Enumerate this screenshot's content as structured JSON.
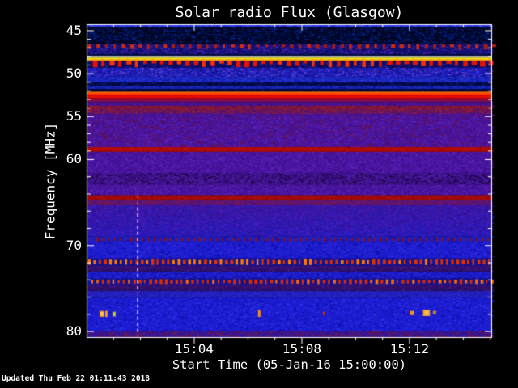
{
  "window": {
    "bg": "#000000",
    "fg": "#ffffff"
  },
  "chart_data": {
    "type": "heatmap",
    "title": "Solar radio Flux (Glasgow)",
    "xlabel": "Start Time (05-Jan-16 15:00:00)",
    "ylabel": "Frequency [MHz]",
    "updated": "Updated Thu Feb 22 01:11:43 2018",
    "x_axis": {
      "unit": "minutes after 15:00:00",
      "min_minutes": 0,
      "max_minutes": 15.07,
      "major_ticks": [
        {
          "minutes": 4,
          "label": "15:04"
        },
        {
          "minutes": 8,
          "label": "15:08"
        },
        {
          "minutes": 12,
          "label": "15:12"
        }
      ],
      "minor_tick_minutes": [
        1,
        2,
        3,
        5,
        6,
        7,
        9,
        10,
        11,
        13,
        14,
        15
      ]
    },
    "y_axis": {
      "unit": "MHz",
      "min_mhz": 44.25,
      "max_mhz": 80.65,
      "major_ticks": [
        {
          "mhz": 45,
          "label": "45"
        },
        {
          "mhz": 50,
          "label": "50"
        },
        {
          "mhz": 55,
          "label": "55"
        },
        {
          "mhz": 60,
          "label": "60"
        },
        {
          "mhz": 70,
          "label": "70"
        },
        {
          "mhz": 80,
          "label": "80"
        }
      ],
      "minor_tick_mhz": [
        46,
        47,
        48,
        49,
        51,
        52,
        53,
        54,
        56,
        57,
        58,
        59,
        62,
        64,
        66,
        68,
        72,
        74,
        76,
        78
      ]
    },
    "bands": [
      {
        "f0": 44.25,
        "f1": 44.55,
        "base": "#2733ee",
        "speckle": {
          "colors": [
            "#4d5cff",
            "#1a23c0"
          ],
          "d": 0.5
        }
      },
      {
        "f0": 44.55,
        "f1": 46.6,
        "base": "#000522",
        "speckle": {
          "colors": [
            "#001e7e",
            "#000f4a",
            "#062ba6",
            "#00081c"
          ],
          "d": 0.6
        }
      },
      {
        "f0": 46.6,
        "f1": 47.75,
        "base": "#0e0e64",
        "speckle": {
          "colors": [
            "#5226bc",
            "#2a1694",
            "#1a1a88"
          ],
          "d": 0.6
        },
        "comb": {
          "color": "#a81e12",
          "alt": "#d02a10",
          "period": 10.4,
          "w": 4,
          "min": 0.25,
          "max": 0.55,
          "anchor": "top"
        }
      },
      {
        "f0": 47.75,
        "f1": 47.95,
        "base": "#020d40"
      },
      {
        "f0": 47.95,
        "f1": 48.14,
        "base": "#fcfadc"
      },
      {
        "f0": 48.14,
        "f1": 48.38,
        "base": "#f0e21e",
        "comb": {
          "color": "#ffa200",
          "period": 10.4,
          "w": 3,
          "min": 0.3,
          "max": 0.5,
          "anchor": "bottom"
        }
      },
      {
        "f0": 48.38,
        "f1": 48.52,
        "base": "#ff9100"
      },
      {
        "f0": 48.52,
        "f1": 49.3,
        "base": "#0a0a5e",
        "speckle": {
          "colors": [
            "#2626a8",
            "#14147e"
          ],
          "d": 0.3
        },
        "comb": {
          "color": "#e61300",
          "alt": "#ff3000",
          "period": 10.4,
          "w": 5,
          "min": 0.35,
          "max": 1.0,
          "anchor": "top"
        }
      },
      {
        "f0": 49.3,
        "f1": 50.35,
        "base": "#1a1aae",
        "speckle": {
          "colors": [
            "#4433cc",
            "#6a48dd",
            "#0e0e7c",
            "#2a2ae0"
          ],
          "d": 0.55
        }
      },
      {
        "f0": 50.35,
        "f1": 51.05,
        "base": "#1c28c4",
        "speckle": {
          "colors": [
            "#0c148e",
            "#2e3ad8"
          ],
          "d": 0.35
        }
      },
      {
        "f0": 51.05,
        "f1": 51.45,
        "base": "#03073e",
        "speckle": {
          "colors": [
            "#0a1a7a"
          ],
          "d": 0.3
        }
      },
      {
        "f0": 51.45,
        "f1": 51.8,
        "base": "#1b26b8",
        "speckle": {
          "colors": [
            "#0c148e"
          ],
          "d": 0.3
        }
      },
      {
        "f0": 51.8,
        "f1": 52.1,
        "base": "#020738",
        "speckle": {
          "colors": [
            "#0a1668"
          ],
          "d": 0.3
        }
      },
      {
        "f0": 52.1,
        "f1": 52.45,
        "base": [
          "#ff7a00",
          "#ff2600"
        ]
      },
      {
        "f0": 52.45,
        "f1": 52.82,
        "base": "#e60d00"
      },
      {
        "f0": 52.82,
        "f1": 53.3,
        "base": [
          "#ae041e",
          "#700c5e"
        ]
      },
      {
        "f0": 53.3,
        "f1": 53.75,
        "base": "#49128e",
        "speckle": {
          "colors": [
            "#5a1a9e",
            "#3a0e78"
          ],
          "d": 0.4
        }
      },
      {
        "f0": 53.75,
        "f1": 54.7,
        "base": [
          "#8c1622",
          "#5c1478"
        ],
        "speckle": {
          "colors": [
            "#9c2228",
            "#4a1278"
          ],
          "d": 0.4
        }
      },
      {
        "f0": 54.7,
        "f1": 58.55,
        "base": "#4a16a2",
        "speckle": {
          "colors": [
            "#3a0f8a",
            "#5e24bc",
            "#44138f",
            "#6a1040"
          ],
          "d": 0.6
        }
      },
      {
        "f0": 58.55,
        "f1": 59.1,
        "base": "#b50d06",
        "speckle": {
          "colors": [
            "#9c0a04"
          ],
          "d": 0.3
        }
      },
      {
        "f0": 59.1,
        "f1": 61.6,
        "base": "#4a16a2",
        "speckle": {
          "colors": [
            "#3a0f8a",
            "#5e24bc",
            "#44138f"
          ],
          "d": 0.6
        }
      },
      {
        "f0": 61.6,
        "f1": 62.9,
        "base": "#44149a",
        "speckle": {
          "colors": [
            "#26084f",
            "#1c0642",
            "#54209f"
          ],
          "d": 0.65
        }
      },
      {
        "f0": 62.9,
        "f1": 64.15,
        "base": "#4a16a2",
        "speckle": {
          "colors": [
            "#3a0f8a",
            "#5e24bc",
            "#44138f"
          ],
          "d": 0.6
        }
      },
      {
        "f0": 64.15,
        "f1": 64.7,
        "base": "#a80c0a",
        "speckle": {
          "colors": [
            "#8e0a06"
          ],
          "d": 0.3
        }
      },
      {
        "f0": 64.7,
        "f1": 65.25,
        "base": "#64156e",
        "speckle": {
          "colors": [
            "#7a1846",
            "#4a1488"
          ],
          "d": 0.5
        }
      },
      {
        "f0": 65.25,
        "f1": 68.95,
        "base": [
          "#42169e",
          "#2a1abe"
        ],
        "speckle": {
          "colors": [
            "#331093",
            "#1e1eb8",
            "#4a20c2"
          ],
          "d": 0.55
        }
      },
      {
        "f0": 68.95,
        "f1": 69.65,
        "base": "#2220c4",
        "speckle": {
          "colors": [
            "#1414a8"
          ],
          "d": 0.3
        },
        "comb": {
          "color": "#7a1038",
          "period": 7,
          "w": 2.5,
          "min": 0.4,
          "max": 0.8,
          "anchor": "mid"
        }
      },
      {
        "f0": 69.65,
        "f1": 71.5,
        "base": "#1d1dd2",
        "speckle": {
          "colors": [
            "#0f0fa8",
            "#3a2ae4",
            "#2424c0"
          ],
          "d": 0.5
        }
      },
      {
        "f0": 71.5,
        "f1": 72.35,
        "base": "#15159e",
        "speckle": {
          "colors": [
            "#0e0e84"
          ],
          "d": 0.3
        },
        "comb": {
          "color": "#e03200",
          "alt": "#ff7a00",
          "period": 6.5,
          "w": 3,
          "min": 0.45,
          "max": 0.85,
          "anchor": "mid"
        }
      },
      {
        "f0": 72.35,
        "f1": 73.1,
        "base": [
          "#3a1078",
          "#231064"
        ],
        "speckle": {
          "colors": [
            "#2a0e6e",
            "#461a8a"
          ],
          "d": 0.4
        }
      },
      {
        "f0": 73.1,
        "f1": 73.85,
        "base": "#1c1ccc",
        "speckle": {
          "colors": [
            "#10109e",
            "#2e2ede"
          ],
          "d": 0.45
        }
      },
      {
        "f0": 73.85,
        "f1": 74.55,
        "base": "#15159e",
        "speckle": {
          "colors": [
            "#0e0e84"
          ],
          "d": 0.3
        },
        "comb": {
          "color": "#d82c00",
          "alt": "#ff6a00",
          "period": 6.5,
          "w": 3,
          "min": 0.45,
          "max": 0.85,
          "anchor": "mid"
        }
      },
      {
        "f0": 74.55,
        "f1": 75.3,
        "base": [
          "#38106e",
          "#22105e"
        ],
        "speckle": {
          "colors": [
            "#2a0e6e",
            "#44188a"
          ],
          "d": 0.4
        }
      },
      {
        "f0": 75.3,
        "f1": 76.1,
        "base": "#2520be",
        "speckle": {
          "colors": [
            "#1a1aa8",
            "#3228d0"
          ],
          "d": 0.45
        }
      },
      {
        "f0": 76.1,
        "f1": 79.95,
        "base": "#1c1cd4",
        "speckle": {
          "colors": [
            "#1111ae",
            "#3232ea",
            "#2020c4"
          ],
          "d": 0.5
        }
      },
      {
        "f0": 79.95,
        "f1": 80.65,
        "base": "#35169a",
        "speckle": {
          "colors": [
            "#471d86",
            "#6a1040",
            "#8c1a22",
            "#2a1490"
          ],
          "d": 0.55
        }
      }
    ],
    "emission_blobs": [
      {
        "m0": 0.48,
        "m1": 0.66,
        "f0": 77.6,
        "f1": 78.3,
        "color": "#f08820",
        "core": "#ffd85a"
      },
      {
        "m0": 0.69,
        "m1": 0.78,
        "f0": 77.6,
        "f1": 78.3,
        "color": "#f09a28"
      },
      {
        "m0": 0.96,
        "m1": 1.08,
        "f0": 77.7,
        "f1": 78.25,
        "color": "#c8c428"
      },
      {
        "m0": 6.37,
        "m1": 6.46,
        "f0": 77.5,
        "f1": 78.3,
        "color": "#f09020"
      },
      {
        "m0": 8.78,
        "m1": 8.85,
        "f0": 77.7,
        "f1": 78.1,
        "color": "#c03010"
      },
      {
        "m0": 12.02,
        "m1": 12.17,
        "f0": 77.6,
        "f1": 78.1,
        "color": "#f09428"
      },
      {
        "m0": 12.5,
        "m1": 12.76,
        "f0": 77.45,
        "f1": 78.2,
        "color": "#f0a030",
        "core": "#ffc850"
      },
      {
        "m0": 12.87,
        "m1": 12.99,
        "f0": 77.6,
        "f1": 78.0,
        "color": "#d08018"
      }
    ],
    "cursor_line": {
      "minutes": 1.9,
      "f0": 64.15,
      "f1": 80.65,
      "dash": 4,
      "gap": 3.5,
      "segments": [
        {
          "f0": 64.15,
          "f1": 65.1,
          "colors": [
            "#ffb400",
            "#e85410"
          ]
        },
        {
          "f0": 65.1,
          "f1": 75.1,
          "colors": [
            "#ededed"
          ]
        },
        {
          "f0": 75.1,
          "f1": 75.9,
          "colors": [
            "#e03010"
          ]
        },
        {
          "f0": 75.9,
          "f1": 80.2,
          "colors": [
            "#ededed"
          ]
        },
        {
          "f0": 80.2,
          "f1": 80.65,
          "colors": [
            "#d83010"
          ]
        }
      ]
    },
    "frame_color": "#ffffff"
  }
}
